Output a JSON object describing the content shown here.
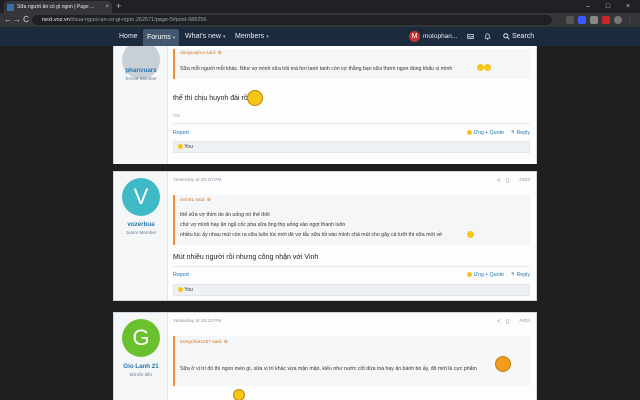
{
  "browser": {
    "tab_title": "Sữa người ăn có gì ngon | Page ...",
    "tab_close": "×",
    "new_tab": "+",
    "url_host": "next.voz.vn",
    "url_path": "/t/sua-nguoi-an-co-gi-ngon.262571/page-5#post-988256",
    "back": "←",
    "forward": "→",
    "reload": "C",
    "minimize": "–",
    "maximize": "□",
    "close": "×"
  },
  "nav": {
    "home": "Home",
    "forums": "Forums",
    "whats_new": "What's new",
    "members": "Members",
    "account_initial": "M",
    "account_name": "motophan...",
    "search": "Search",
    "caret": "▾"
  },
  "posts": [
    {
      "username": "phanvuars",
      "user_title": "Senior Member",
      "avatar_letter": "",
      "avatar_color": "#c9cfd6",
      "quote_attr": "dangcaphoi said: ⊕",
      "quote_lines": [
        "Sữa mỗi người mỗi khác. Như vợ mình sữa hôi mà hơi tanh tanh còn vợ thằng bạn sữa thơm ngon đúng khẩu vị mình"
      ],
      "message": "thế thì chịu huynh đài rồi",
      "signature": "VG",
      "report": "Report",
      "like": "Ưng",
      "quote": "+ Quote",
      "reply": "↰ Reply",
      "reactions": "You"
    },
    {
      "date": "Yesterday at 20:10 PM",
      "post_number": "#403",
      "username": "vozerbua",
      "user_title": "Junior Member",
      "avatar_letter": "V",
      "avatar_color": "#3fb9c6",
      "quote_attr": "vinh91 said: ⊕",
      "quote_lines": [
        "thế sữa vợ thím do ăn uống nó thế thôi",
        "chứ vợ mình hay ăn ngũ cốc pha sữa ông thọ uống vào ngọt thanh luôn",
        "nhiều lúc ấy nhau mút còn ra sữa luôn lúc mới đẻ vợ tắc sữa tối nào mình chả mút cho gây cả lưỡi thì sữa mới về"
      ],
      "message": "Mút nhiều người rồi nhưng công nhận với Vinh",
      "report": "Report",
      "like": "Ưng",
      "quote": "+ Quote",
      "reply": "↰ Reply",
      "reactions": "You"
    },
    {
      "date": "Yesterday at 20:23 PM",
      "post_number": "#404",
      "username": "Gio Lanh 21",
      "user_title": "Đã tốn tiền",
      "avatar_letter": "G",
      "avatar_color": "#6ac12e",
      "quote_attr": "trangnhat1297 said: ⊕",
      "quote_lines": [
        "Sữa ở vị trí đó thì ngon méo gì, sữa vị trí khác vừa mặn mặn, kiểu như nước cốt dừa mà hay ăn bánh bò ấy, đô mới là cực phẩm"
      ]
    }
  ],
  "colors": {
    "nav_bg": "#1c2a3e",
    "link": "#2577b1",
    "quote_border": "#f18e3a",
    "page_bg": "#1f1f1f"
  },
  "icons": {
    "share": "share-icon",
    "bookmark": "bookmark-icon",
    "bell": "bell-icon",
    "inbox": "inbox-icon",
    "search": "search-icon"
  }
}
